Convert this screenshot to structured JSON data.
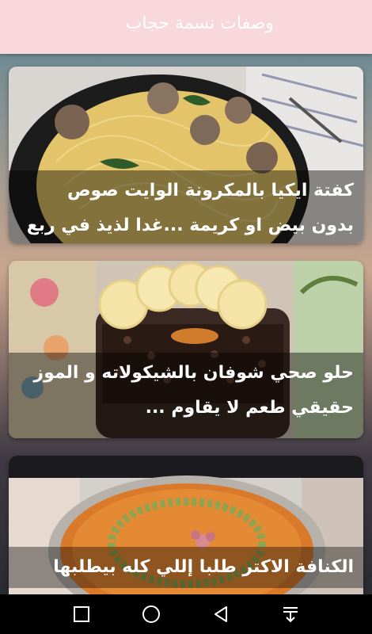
{
  "app_bar": {
    "title": "وصفات نسمة حجاب",
    "background_color": "#f8d8dd"
  },
  "recipes": [
    {
      "title": "كفتة ايكيا بالمكرونة الوايت صوص بدون بيض او كريمة ...غدا لذيذ في ربع ساعة..!"
    },
    {
      "title": "حلو صحي شوفان بالشيكولاته و الموز حقيقي طعم لا يقاوم ..."
    },
    {
      "title": "الكنافة الاكتر طلبا إللي كله بيطلبها"
    }
  ],
  "nav_bar": {
    "buttons": [
      "recents-square-icon",
      "home-circle-icon",
      "back-triangle-icon",
      "notifications-pull-icon"
    ]
  }
}
